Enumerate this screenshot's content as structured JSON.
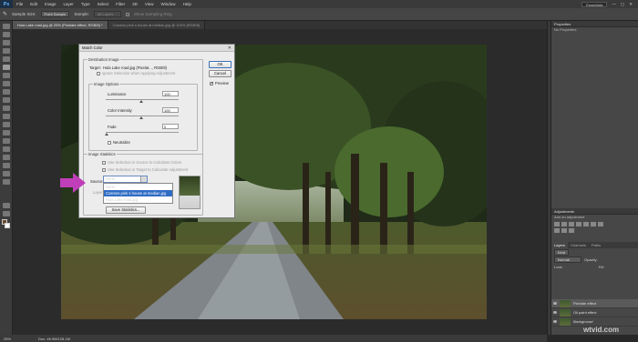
{
  "app": {
    "logo": "Ps",
    "menus": [
      "File",
      "Edit",
      "Image",
      "Layer",
      "Type",
      "Select",
      "Filter",
      "3D",
      "View",
      "Window",
      "Help"
    ],
    "workspace": "Essentials"
  },
  "options": {
    "sample_size_label": "Sample Size:",
    "sample_size_value": "Point Sample",
    "sample_label": "Sample:",
    "sample_value": "All Layers",
    "show_ring": "Show Sampling Ring"
  },
  "tabs": [
    "Hula Lake road.jpg @ 25% (Pixelate effect, RGB/8) *",
    "Cosmos pink s house at median.jpg @ 100% (RGB/8)"
  ],
  "status": {
    "zoom": "25%",
    "doc": "Doc: 46.9M/128.1M"
  },
  "dialog": {
    "title": "Match Color",
    "destination_group": "Destination Image",
    "target_label": "Target:",
    "target_value": "Hula Lake road.jpg (Pixelat..., RGB/8)",
    "ignore_selection": "Ignore Selection when Applying Adjustment",
    "image_options_group": "Image Options",
    "luminance_label": "Luminance",
    "luminance_value": "100",
    "intensity_label": "Color Intensity",
    "intensity_value": "100",
    "fade_label": "Fade",
    "fade_value": "0",
    "neutralize": "Neutralize",
    "stats_group": "Image Statistics",
    "use_sel_source": "Use Selection in Source to Calculate Colors",
    "use_sel_target": "Use Selection in Target to Calculate Adjustment",
    "source_label": "Source:",
    "source_value": "None",
    "layer_label": "Layer:",
    "save_stats": "Save Statistics...",
    "ok": "OK",
    "cancel": "Cancel",
    "preview": "Preview",
    "source_options": [
      "None",
      "Cosmos pink s house at median.jpg",
      "Hula Lake road.jpg"
    ]
  },
  "panels": {
    "properties_title": "Properties",
    "no_properties": "No Properties",
    "adjustments_title": "Adjustments",
    "add_adjustment": "Add an adjustment",
    "layers_tabs": [
      "Layers",
      "Channels",
      "Paths"
    ],
    "blend_mode": "Normal",
    "opacity": "Opacity:",
    "lock": "Lock:",
    "fill": "Fill:",
    "layers": [
      "Pixelate effect",
      "Oil paint effect",
      "Background"
    ]
  },
  "watermark": "wtvid.com",
  "colors": {
    "accent": "#2f6cc4",
    "arrow": "#c03fb9"
  }
}
